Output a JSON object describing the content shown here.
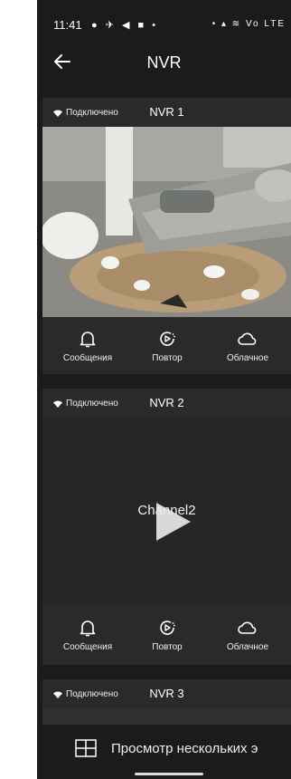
{
  "status_bar": {
    "time": "11:41",
    "left_icons": "● ✈ ◀ ■ •",
    "right_icons": "• ▴ ≋ Vo LTE"
  },
  "app_bar": {
    "title": "NVR"
  },
  "cards": [
    {
      "name": "NVR 1",
      "status": "Подключено"
    },
    {
      "name": "NVR 2",
      "status": "Подключено",
      "channel": "Channel2"
    },
    {
      "name": "NVR 3",
      "status": "Подключено"
    }
  ],
  "actions": {
    "messages": "Сообщения",
    "replay": "Повтор",
    "cloud": "Облачное"
  },
  "bottom": {
    "multi_view": "Просмотр нескольких э"
  },
  "colors": {
    "background": "#1b1b1b",
    "card": "#2a2a2a",
    "text": "#ffffff"
  }
}
